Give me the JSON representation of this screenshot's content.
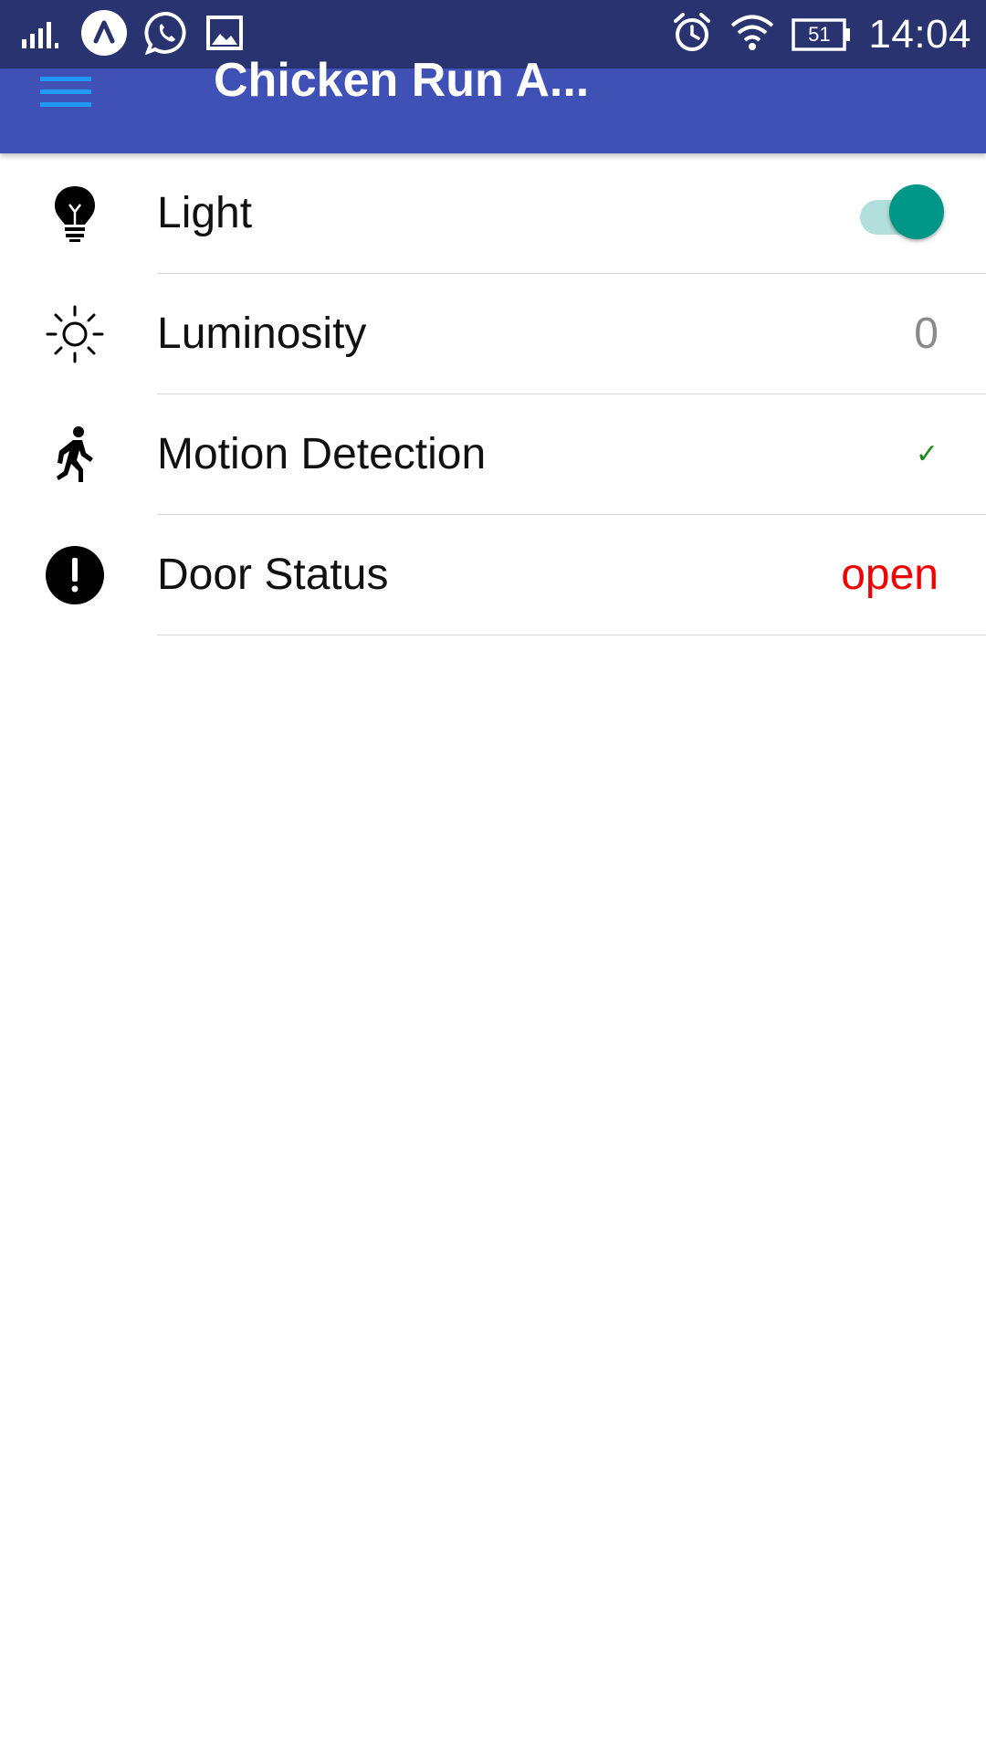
{
  "status_bar": {
    "icons_left": [
      "signal-icon",
      "app-notification-icon",
      "whatsapp-icon",
      "image-icon"
    ],
    "icons_right": [
      "alarm-icon",
      "wifi-icon",
      "battery-icon"
    ],
    "battery_level": "51",
    "time": "14:04"
  },
  "app_bar": {
    "title": "Chicken Run A...",
    "menu_icon": "hamburger-menu-icon",
    "color": "#3f51b5"
  },
  "rows": [
    {
      "icon": "lightbulb-icon",
      "label": "Light",
      "control": "toggle",
      "on": true
    },
    {
      "icon": "sun-icon",
      "label": "Luminosity",
      "value": "0",
      "value_color": "#8a8a8a"
    },
    {
      "icon": "walking-person-icon",
      "label": "Motion Detection",
      "value": "✓",
      "value_color": "#1a8a1a"
    },
    {
      "icon": "alert-circle-icon",
      "label": "Door Status",
      "value": "open",
      "value_color": "#f00000"
    }
  ],
  "colors": {
    "status_bar": "#283370",
    "toggle_thumb": "#009688",
    "toggle_track": "#b2dfdb"
  }
}
